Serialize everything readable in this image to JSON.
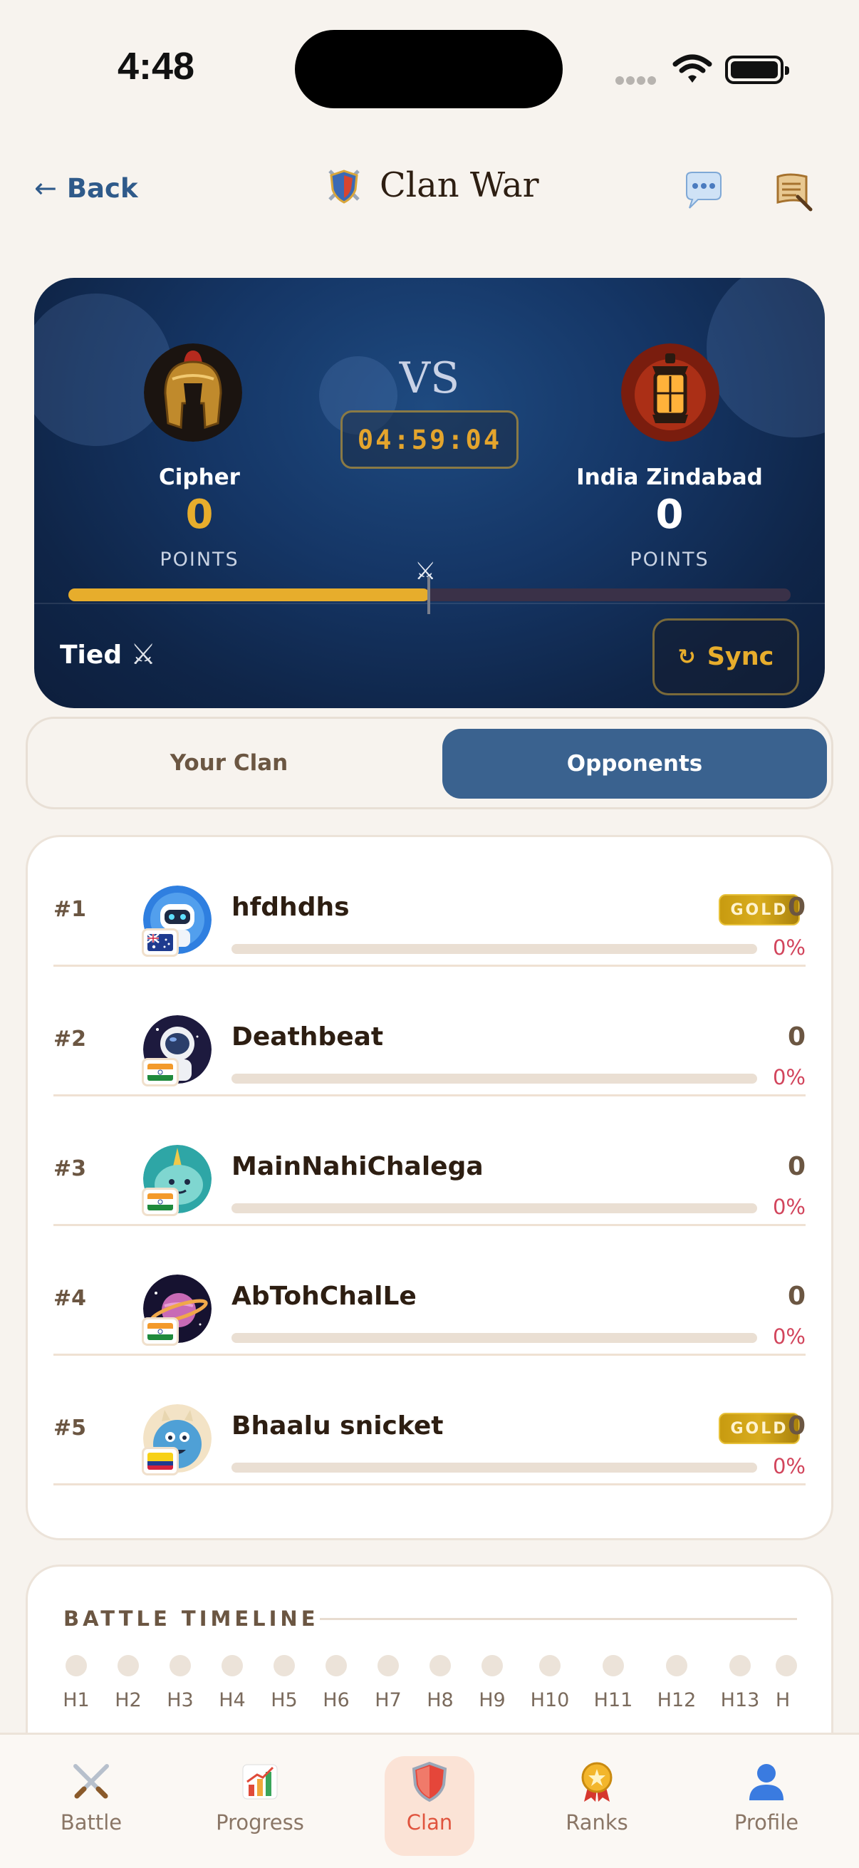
{
  "status_bar": {
    "time": "4:48"
  },
  "header": {
    "back_label": "Back",
    "back_arrow": "←",
    "title": "Clan War",
    "title_icon": "shield-swords-icon",
    "chat_icon": "chat-bubble-icon",
    "rules_icon": "scroll-icon"
  },
  "battle": {
    "vs": "VS",
    "timer": "04:59:04",
    "left": {
      "name": "Cipher",
      "score": "0",
      "points_label": "POINTS",
      "avatar": "spartan-helmet"
    },
    "right": {
      "name": "India Zindabad",
      "score": "0",
      "points_label": "POINTS",
      "avatar": "lantern"
    },
    "progress": 0.5,
    "status": "Tied",
    "status_icon": "crossed-swords-icon",
    "sync_label": "Sync",
    "sync_icon": "↻",
    "colors": {
      "left": "#e7ad2c",
      "right": "#3a3148",
      "background": "#153666"
    }
  },
  "tabs": {
    "your_clan": "Your Clan",
    "opponents": "Opponents",
    "active": "opponents"
  },
  "players": [
    {
      "rank": "#1",
      "name": "hfdhdhs",
      "score": "0",
      "percent": "0%",
      "badge": "GOLD",
      "flag": "australia",
      "avatar": "robot",
      "progress": 0
    },
    {
      "rank": "#2",
      "name": "Deathbeat",
      "score": "0",
      "percent": "0%",
      "badge": "",
      "flag": "india",
      "avatar": "astronaut",
      "progress": 0
    },
    {
      "rank": "#3",
      "name": "MainNahiChalega",
      "score": "0",
      "percent": "0%",
      "badge": "",
      "flag": "india",
      "avatar": "narwhal",
      "progress": 0
    },
    {
      "rank": "#4",
      "name": "AbTohChalLe",
      "score": "0",
      "percent": "0%",
      "badge": "",
      "flag": "india",
      "avatar": "planet",
      "progress": 0
    },
    {
      "rank": "#5",
      "name": "Bhaalu snicket",
      "score": "0",
      "percent": "0%",
      "badge": "GOLD",
      "flag": "colombia",
      "avatar": "blue-monster",
      "progress": 0
    }
  ],
  "timeline": {
    "title": "BATTLE TIMELINE",
    "hours": [
      "H1",
      "H2",
      "H3",
      "H4",
      "H5",
      "H6",
      "H7",
      "H8",
      "H9",
      "H10",
      "H11",
      "H12",
      "H13",
      "H"
    ]
  },
  "nav": [
    {
      "label": "Battle",
      "icon": "crossed-swords-icon",
      "active": false
    },
    {
      "label": "Progress",
      "icon": "bar-chart-icon",
      "active": false
    },
    {
      "label": "Clan",
      "icon": "shield-icon",
      "active": true
    },
    {
      "label": "Ranks",
      "icon": "medal-icon",
      "active": false
    },
    {
      "label": "Profile",
      "icon": "user-icon",
      "active": false
    }
  ]
}
